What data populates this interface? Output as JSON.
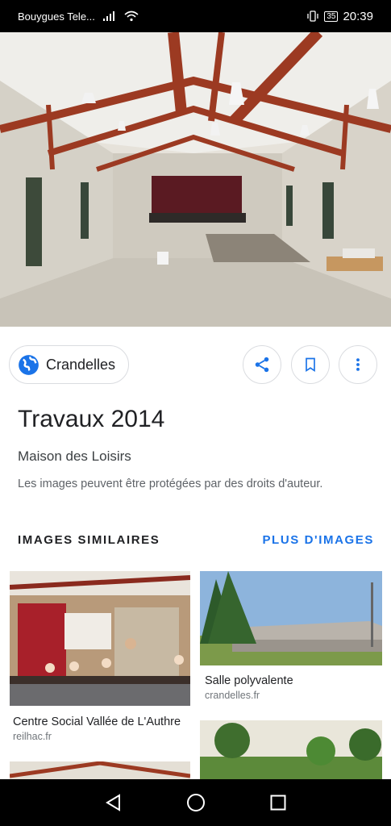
{
  "status": {
    "carrier": "Bouygues Tele...",
    "battery": "35",
    "time": "20:39"
  },
  "hero": {
    "icon": "photo-hall-interior"
  },
  "source": {
    "label": "Crandelles",
    "icon": "globe-icon"
  },
  "actions": {
    "share_icon": "share-icon",
    "save_icon": "bookmark-icon",
    "more_icon": "more-vert-icon"
  },
  "detail": {
    "title": "Travaux 2014",
    "subtitle": "Maison des Loisirs",
    "copyright": "Les images peuvent être protégées par des droits d'auteur."
  },
  "similar": {
    "heading": "IMAGES SIMILAIRES",
    "more": "PLUS D'IMAGES",
    "items": [
      {
        "title": "Centre Social Vallée de L'Authre",
        "source": "reilhac.fr"
      },
      {
        "title": "Salle polyvalente",
        "source": "crandelles.fr"
      }
    ]
  },
  "colors": {
    "accent": "#1a73e8",
    "icon": "#1a73e8"
  }
}
